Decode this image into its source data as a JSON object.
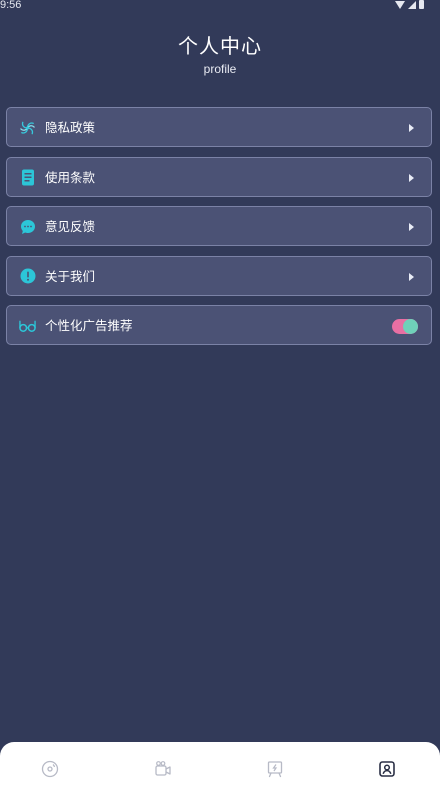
{
  "status_bar": {
    "time": "9:56"
  },
  "header": {
    "title": "个人中心",
    "subtitle": "profile"
  },
  "menu": {
    "items": [
      {
        "label": "隐私政策",
        "icon": "privacy-swirl-icon"
      },
      {
        "label": "使用条款",
        "icon": "document-icon"
      },
      {
        "label": "意见反馈",
        "icon": "chat-bubble-icon"
      },
      {
        "label": "关于我们",
        "icon": "info-icon"
      }
    ],
    "toggle_item": {
      "label": "个性化广告推荐",
      "icon": "glasses-icon",
      "enabled": true
    }
  },
  "bottom_nav": {
    "items": [
      {
        "icon": "disc-icon",
        "active": false
      },
      {
        "icon": "camera-icon",
        "active": false
      },
      {
        "icon": "board-icon",
        "active": false
      },
      {
        "icon": "profile-icon",
        "active": true
      }
    ]
  },
  "colors": {
    "background": "#323a59",
    "card": "#4b5275",
    "card_border": "#7b82a6",
    "accent_teal": "#2cc6d8",
    "toggle_track": "#e86fa3",
    "toggle_knob": "#6fd1b9"
  }
}
